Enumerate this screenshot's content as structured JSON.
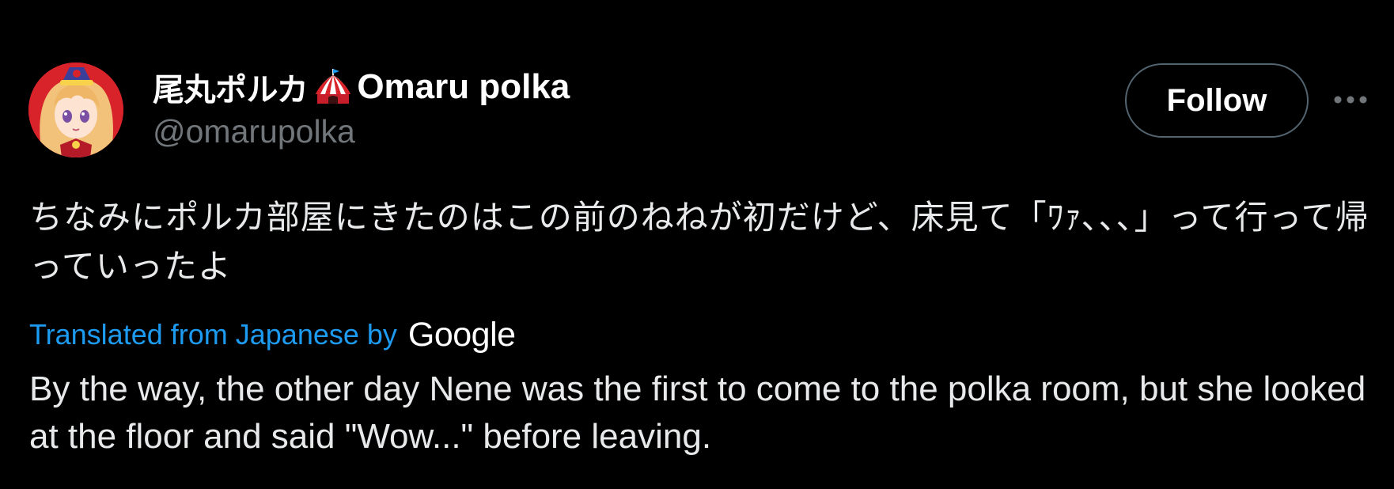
{
  "author": {
    "display_name_ja": "尾丸ポルカ",
    "display_name_emoji": "circus-tent-icon",
    "display_name_latin": "Omaru polka",
    "handle": "@omarupolka",
    "avatar": "avatar-image"
  },
  "actions": {
    "follow_label": "Follow",
    "more_icon": "more-dots-icon"
  },
  "tweet": {
    "text_original": "ちなみにポルカ部屋にきたのはこの前のねねが初だけど、床見て「ﾜｧ､､､」って行って帰っていったよ",
    "translation_label": "Translated from Japanese by",
    "translation_provider": "Google",
    "text_translated": "By the way, the other day Nene was the first to come to the polka room, but she looked at the floor and said \"Wow...\" before leaving."
  },
  "colors": {
    "background": "#000000",
    "text_primary": "#e7e9ea",
    "text_secondary": "#71767b",
    "link": "#1d9bf0",
    "button_border": "#536471",
    "avatar_bg": "#d8232a"
  }
}
